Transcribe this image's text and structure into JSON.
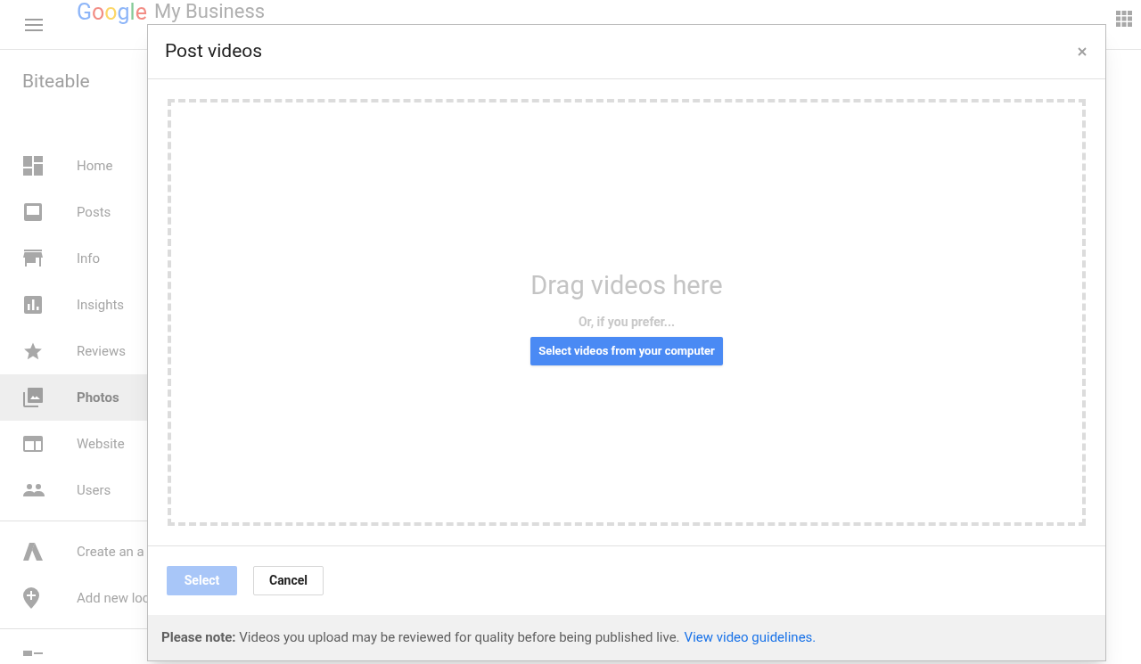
{
  "header": {
    "logo": "Google",
    "product": "My Business"
  },
  "sidebar": {
    "business_name": "Biteable",
    "groups": [
      [
        {
          "label": "Home",
          "selected": false
        },
        {
          "label": "Posts",
          "selected": false
        },
        {
          "label": "Info",
          "selected": false
        },
        {
          "label": "Insights",
          "selected": false
        },
        {
          "label": "Reviews",
          "selected": false
        },
        {
          "label": "Photos",
          "selected": true
        },
        {
          "label": "Website",
          "selected": false
        },
        {
          "label": "Users",
          "selected": false
        }
      ],
      [
        {
          "label": "Create an a",
          "selected": false
        },
        {
          "label": "Add new loc",
          "selected": false
        }
      ]
    ]
  },
  "dialog": {
    "title": "Post videos",
    "dropzone": {
      "heading": "Drag videos here",
      "subtext": "Or, if you prefer...",
      "button": "Select videos from your computer"
    },
    "buttons": [
      {
        "label": "Select",
        "disabled": true
      },
      {
        "label": "Cancel",
        "disabled": false
      }
    ],
    "note": {
      "text": "**Please note:** Videos you upload may be reviewed for quality before being published live.",
      "link": "View video guidelines."
    }
  }
}
